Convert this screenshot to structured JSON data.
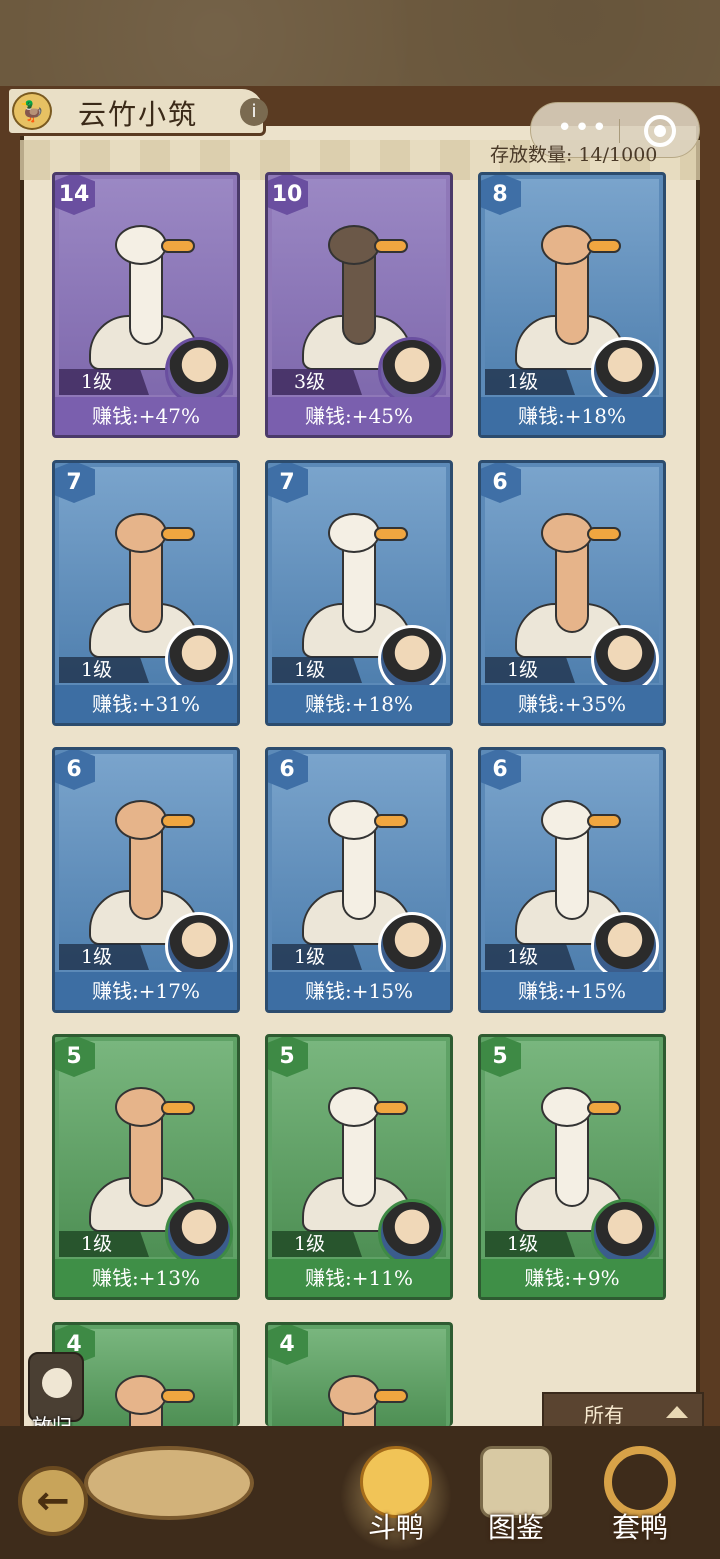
{
  "header": {
    "title": "云竹小筑",
    "info_label": "i",
    "storage_label": "存放数量: 14/1000",
    "menu_dots": "•••"
  },
  "cards": [
    {
      "rarity": "purple",
      "stars": "14",
      "level": "1级",
      "earn": "赚钱:+47%"
    },
    {
      "rarity": "purple",
      "stars": "10",
      "level": "3级",
      "earn": "赚钱:+45%"
    },
    {
      "rarity": "blue",
      "stars": "8",
      "level": "1级",
      "earn": "赚钱:+18%"
    },
    {
      "rarity": "blue",
      "stars": "7",
      "level": "1级",
      "earn": "赚钱:+31%"
    },
    {
      "rarity": "blue",
      "stars": "7",
      "level": "1级",
      "earn": "赚钱:+18%"
    },
    {
      "rarity": "blue",
      "stars": "6",
      "level": "1级",
      "earn": "赚钱:+35%"
    },
    {
      "rarity": "blue",
      "stars": "6",
      "level": "1级",
      "earn": "赚钱:+17%"
    },
    {
      "rarity": "blue",
      "stars": "6",
      "level": "1级",
      "earn": "赚钱:+15%"
    },
    {
      "rarity": "blue",
      "stars": "6",
      "level": "1级",
      "earn": "赚钱:+15%"
    },
    {
      "rarity": "green",
      "stars": "5",
      "level": "1级",
      "earn": "赚钱:+13%"
    },
    {
      "rarity": "green",
      "stars": "5",
      "level": "1级",
      "earn": "赚钱:+11%"
    },
    {
      "rarity": "green",
      "stars": "5",
      "level": "1级",
      "earn": "赚钱:+9%"
    },
    {
      "rarity": "green",
      "stars": "4"
    },
    {
      "rarity": "green",
      "stars": "4"
    }
  ],
  "controls": {
    "recycle_label": "放归",
    "sort_label": "所有"
  },
  "nav": {
    "fight": "斗鸭",
    "codex": "图鉴",
    "catch": "套鸭"
  },
  "colors": {
    "purple": "#8f78b8",
    "blue": "#5c8ab8",
    "green": "#5fa266",
    "panel": "#ece2cb"
  }
}
